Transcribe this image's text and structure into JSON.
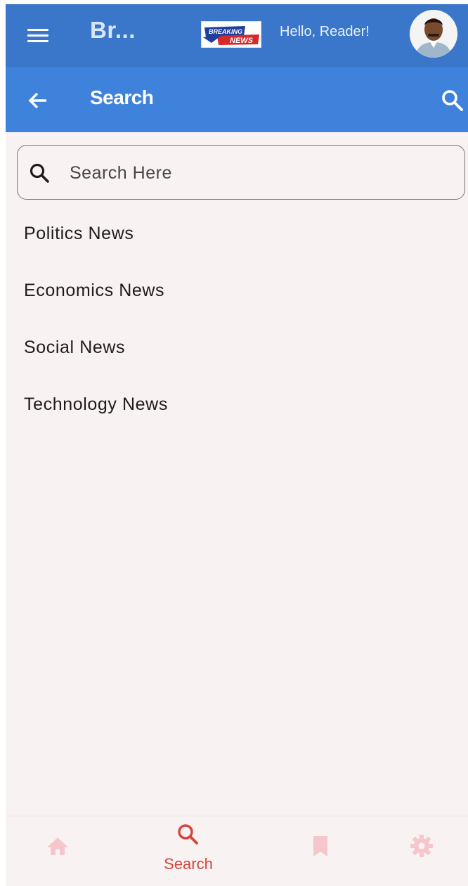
{
  "appbar": {
    "title": "Br...",
    "greeting": "Hello, Reader!",
    "logo_text_top": "BREAKING",
    "logo_text_bottom": "NEWS"
  },
  "header": {
    "title": "Search"
  },
  "search": {
    "placeholder": "Search Here",
    "value": ""
  },
  "categories": [
    "Politics News",
    "Economics News",
    "Social News",
    "Technology News"
  ],
  "bottom_nav": {
    "items": [
      {
        "icon": "home-icon",
        "label": "",
        "active": false
      },
      {
        "icon": "search-icon",
        "label": "Search",
        "active": true
      },
      {
        "icon": "bookmark-icon",
        "label": "",
        "active": false
      },
      {
        "icon": "settings-icon",
        "label": "",
        "active": false
      }
    ]
  },
  "colors": {
    "appbar": "#3a76c9",
    "header": "#3f82dc",
    "background": "#f8f3f2",
    "nav_active": "#d6453c",
    "nav_inactive": "#f5c6cb"
  }
}
